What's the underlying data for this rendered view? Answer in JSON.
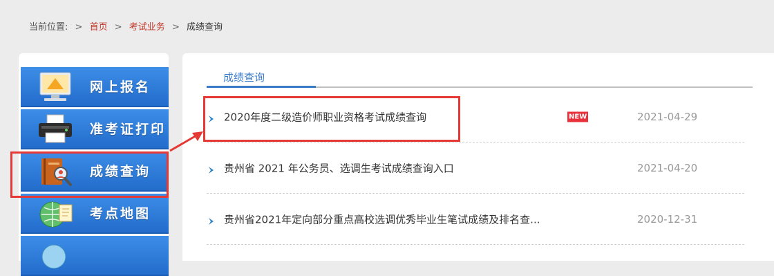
{
  "breadcrumb": {
    "prefix": "当前位置:",
    "separator": ">",
    "items": [
      "首页",
      "考试业务",
      "成绩查询"
    ]
  },
  "sidebar": {
    "items": [
      {
        "label": "网上报名",
        "icon": "computer-icon"
      },
      {
        "label": "准考证打印",
        "icon": "printer-icon"
      },
      {
        "label": "成绩查询",
        "icon": "book-search-icon",
        "active": true
      },
      {
        "label": "考点地图",
        "icon": "globe-map-icon"
      },
      {
        "label": "",
        "icon": "globe-icon"
      }
    ]
  },
  "tabs": {
    "active_label": "成绩查询"
  },
  "news": [
    {
      "title": "2020年度二级造价师职业资格考试成绩查询",
      "badge": "NEW",
      "date": "2021-04-29",
      "highlighted": true
    },
    {
      "title": "贵州省 2021 年公务员、选调生考试成绩查询入口",
      "date": "2021-04-20"
    },
    {
      "title": "贵州省2021年定向部分重点高校选调优秀毕业生笔试成绩及排名查...",
      "date": "2020-12-31"
    }
  ],
  "colors": {
    "accent_blue": "#3a7bc8",
    "menu_blue": "#2e7bd8",
    "highlight_red": "#e53935",
    "badge_red": "#e8313a",
    "link_red": "#c0392b"
  }
}
